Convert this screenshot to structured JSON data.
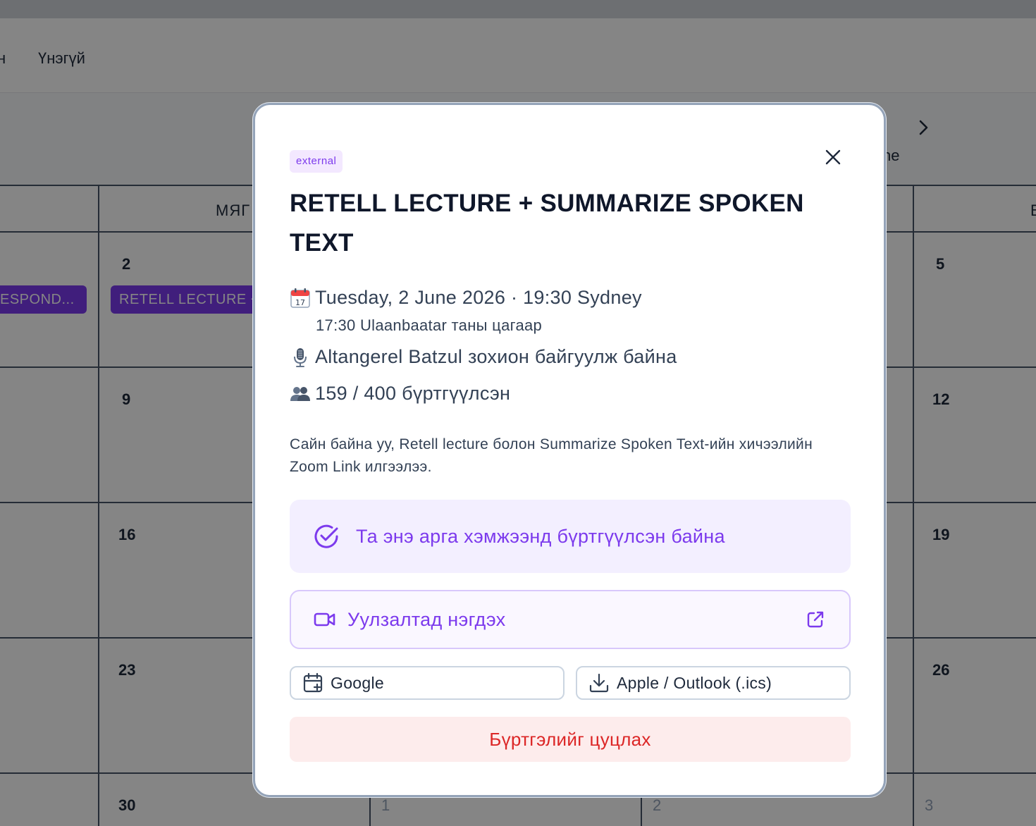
{
  "background": {
    "filter_tabs": [
      "н",
      "Үнэгүй"
    ],
    "nav": {
      "next_label": "ne"
    },
    "day_headers": [
      "МЯГ",
      "Б"
    ],
    "day_numbers": {
      "c1": [
        "2",
        "9",
        "16",
        "23",
        "30"
      ],
      "c4": [
        "1"
      ],
      "c5": [
        "2"
      ],
      "c6": [
        "5",
        "12",
        "19",
        "26",
        "3"
      ]
    },
    "events": [
      {
        "label": "ESPOND..."
      },
      {
        "label": "RETELL LECTURE +"
      }
    ]
  },
  "modal": {
    "badge": "external",
    "title": "RETELL LECTURE + SUMMARIZE SPOKEN TEXT",
    "date_line": "Tuesday, 2 June 2026 · 19:30 Sydney",
    "local_time": "17:30 Ulaanbaatar таны цагаар",
    "host_line": "Altangerel Batzul зохион байгуулж байна",
    "registrations": "159 / 400 бүртгүүлсэн",
    "description": "Сайн байна уу, Retell lecture болон Summarize Spoken Text-ийн хичээлийн Zoom Link илгээлээ.",
    "registered_notice": "Та энэ арга хэмжээнд бүртгүүлсэн байна",
    "join_label": "Уулзалтад нэгдэх",
    "google_label": "Google",
    "ics_label": "Apple / Outlook (.ics)",
    "cancel_label": "Бүртгэлийг цуцлах"
  },
  "colors": {
    "accent": "#7c3aed",
    "danger": "#dc2626",
    "overlay": "rgba(0,0,0,0.48)"
  },
  "icons": [
    "close-icon",
    "calendar-emoji-icon",
    "microphone-emoji-icon",
    "people-emoji-icon",
    "check-circle-icon",
    "video-camera-icon",
    "external-link-icon",
    "calendar-plus-icon",
    "download-icon",
    "chevron-right-icon"
  ]
}
